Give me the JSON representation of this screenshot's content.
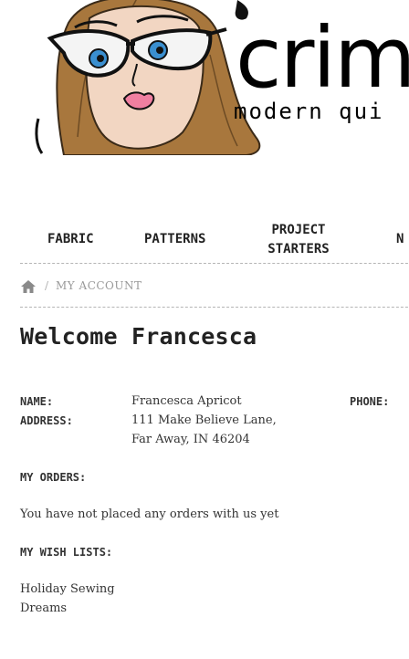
{
  "brand": {
    "name": "crim",
    "tagline": "modern qui",
    "logo_icon": "cartoon-woman-glasses-logo"
  },
  "nav": {
    "items": [
      {
        "label": "FABRIC"
      },
      {
        "label": "PATTERNS"
      },
      {
        "label": "PROJECT STARTERS"
      },
      {
        "label": "N"
      }
    ]
  },
  "breadcrumb": {
    "home_icon": "home-icon",
    "separator": "/",
    "current": "MY ACCOUNT"
  },
  "account": {
    "welcome": "Welcome Francesca",
    "name_label": "NAME:",
    "name_value": "Francesca Apricot",
    "address_label": "ADDRESS:",
    "address_line1": "111 Make Believe Lane,",
    "address_line2": "Far Away, IN 46204",
    "phone_label": "PHONE:",
    "orders_label": "MY ORDERS:",
    "orders_empty": "You have not placed any orders with us yet",
    "wishlists_label": "MY WISH LISTS:",
    "wishlists": [
      "Holiday Sewing",
      "Dreams"
    ]
  },
  "colors": {
    "hair": "#a8773d",
    "skin": "#f2d6c2",
    "eyes": "#3a8fd0",
    "lips": "#f07fa0",
    "divider": "#b5b5b5",
    "muted_text": "#9a9a9a"
  }
}
